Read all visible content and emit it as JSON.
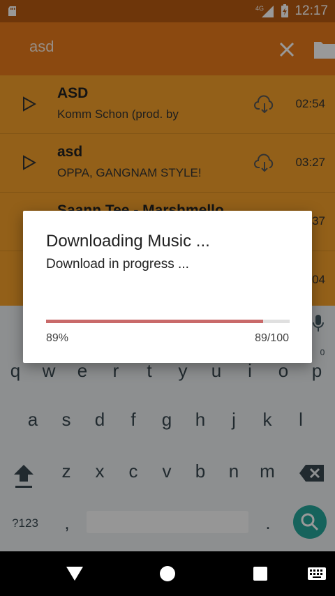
{
  "status_bar": {
    "network": "4G",
    "time": "12:17"
  },
  "app_bar": {
    "search_query": "asd"
  },
  "songs": [
    {
      "title": "ASD",
      "subtitle": "Komm Schon (prod. by",
      "duration": "02:54"
    },
    {
      "title": "asd",
      "subtitle": "OPPA, GANGNAM STYLE!",
      "duration": "03:27"
    },
    {
      "title": "Saann Tee - Marshmello",
      "subtitle": "",
      "duration": "37"
    },
    {
      "title": "",
      "subtitle": "",
      "duration": "04"
    }
  ],
  "dialog": {
    "title": "Downloading Music ...",
    "message": "Download in progress ...",
    "percent_label": "89%",
    "count_label": "89/100",
    "progress": 0.89
  },
  "keyboard": {
    "row1": [
      "q",
      "w",
      "e",
      "r",
      "t",
      "y",
      "u",
      "i",
      "o",
      "p"
    ],
    "row2": [
      "a",
      "s",
      "d",
      "f",
      "g",
      "h",
      "j",
      "k",
      "l"
    ],
    "row3": [
      "z",
      "x",
      "c",
      "v",
      "b",
      "n",
      "m"
    ],
    "symbols_key": "?123",
    "comma_key": ",",
    "period_key": ".",
    "p_hint": "0"
  },
  "colors": {
    "primary": "#e87a1c",
    "list_bg": "#f5a02a",
    "accent": "#26a69a",
    "progress": "#c96a6a"
  }
}
